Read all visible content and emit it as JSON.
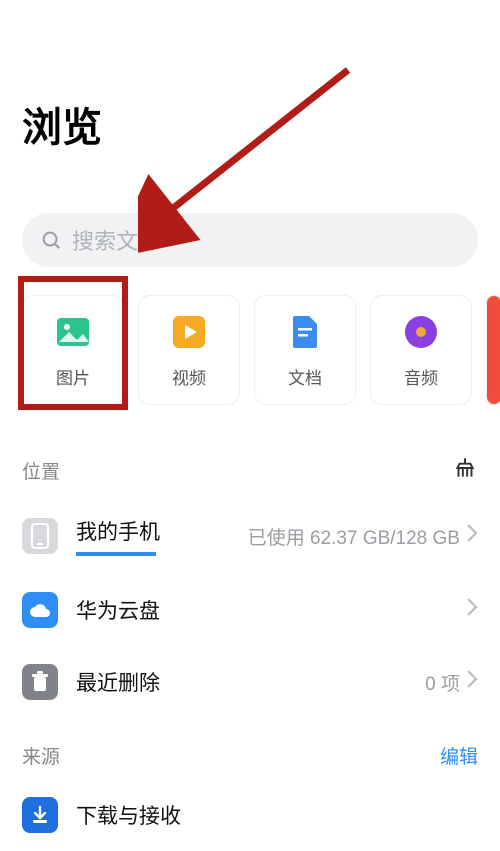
{
  "header": {
    "title": "浏览"
  },
  "search": {
    "placeholder": "搜索文件"
  },
  "categories": [
    {
      "key": "images",
      "label": "图片",
      "icon": "image-icon",
      "color": "#2bc48a"
    },
    {
      "key": "videos",
      "label": "视频",
      "icon": "play-icon",
      "color": "#f6a923"
    },
    {
      "key": "docs",
      "label": "文档",
      "icon": "doc-icon",
      "color": "#3a8dee"
    },
    {
      "key": "audio",
      "label": "音频",
      "icon": "audio-icon",
      "color": "#8a3fe0"
    }
  ],
  "sections": {
    "location_label": "位置",
    "source_label": "来源",
    "edit_label": "编辑"
  },
  "location_items": {
    "my_phone": {
      "label": "我的手机",
      "status": "已使用 62.37 GB/128 GB"
    },
    "cloud": {
      "label": "华为云盘"
    },
    "trash": {
      "label": "最近删除",
      "count_text": "0 项"
    }
  },
  "source_items": {
    "downloads": {
      "label": "下载与接收"
    }
  },
  "annotations": {
    "arrow_color": "#b11c16",
    "highlight_color": "#b11c16"
  }
}
